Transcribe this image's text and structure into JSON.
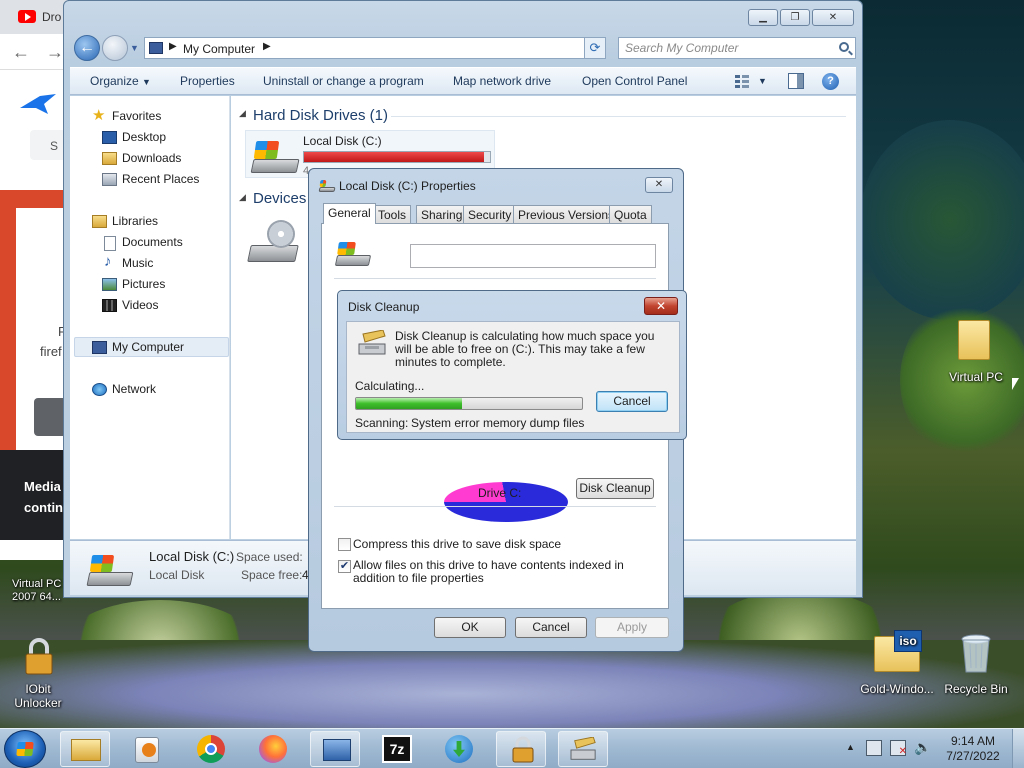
{
  "browser": {
    "tab_title": "Dro",
    "side_texts": [
      "S",
      "F",
      "firef"
    ],
    "banner_line1": "Media",
    "banner_line2": "continu"
  },
  "explorer": {
    "address": {
      "crumb": "My Computer",
      "search_placeholder": "Search My Computer"
    },
    "commands": [
      "Organize",
      "Properties",
      "Uninstall or change a program",
      "Map network drive",
      "Open Control Panel"
    ],
    "nav": {
      "favorites": "Favorites",
      "desktop": "Desktop",
      "downloads": "Downloads",
      "recent": "Recent Places",
      "libraries": "Libraries",
      "documents": "Documents",
      "music": "Music",
      "pictures": "Pictures",
      "videos": "Videos",
      "computer": "My Computer",
      "network": "Network"
    },
    "groups": {
      "hdd": "Hard Disk Drives (1)",
      "devices": "Devices"
    },
    "drive": {
      "name": "Local Disk (C:)",
      "used_fraction": 0.97,
      "bar_color": "#d42020"
    },
    "details": {
      "name": "Local Disk (C:)",
      "type": "Local Disk",
      "used_label": "Space used:",
      "free_label": "Space free:",
      "free_value": "4"
    }
  },
  "properties": {
    "title": "Local Disk (C:) Properties",
    "tabs": [
      "General",
      "Tools",
      "Sharing",
      "Security",
      "Previous Versions",
      "Quota"
    ],
    "active_tab": "General",
    "drive_caption": "Drive C:",
    "disk_cleanup_button": "Disk Cleanup",
    "compress_label": "Compress this drive to save disk space",
    "compress_checked": false,
    "index_label": "Allow files on this drive to have contents indexed in addition to file properties",
    "index_checked": true,
    "ok": "OK",
    "cancel": "Cancel",
    "apply": "Apply",
    "pie_colors": {
      "used": "#2a2adb",
      "free": "#ff3bd1"
    }
  },
  "cleanup": {
    "title": "Disk Cleanup",
    "message": "Disk Cleanup is calculating how much space you will be able to free on  (C:). This may take a few minutes to complete.",
    "status": "Calculating...",
    "progress_fraction": 0.47,
    "cancel": "Cancel",
    "scanning_label": "Scanning:",
    "scanning_item": "System error memory dump files"
  },
  "desktop_icons": {
    "virtual_pc": "Virtual PC",
    "virtual_pc_2007": "Virtual PC 2007 64...",
    "iobit": "IObit Unlocker",
    "gold_windows": "Gold-Windo...",
    "recycle_bin": "Recycle Bin"
  },
  "taskbar": {
    "time": "9:14 AM",
    "date": "7/27/2022",
    "tray_arrow": "▲"
  }
}
